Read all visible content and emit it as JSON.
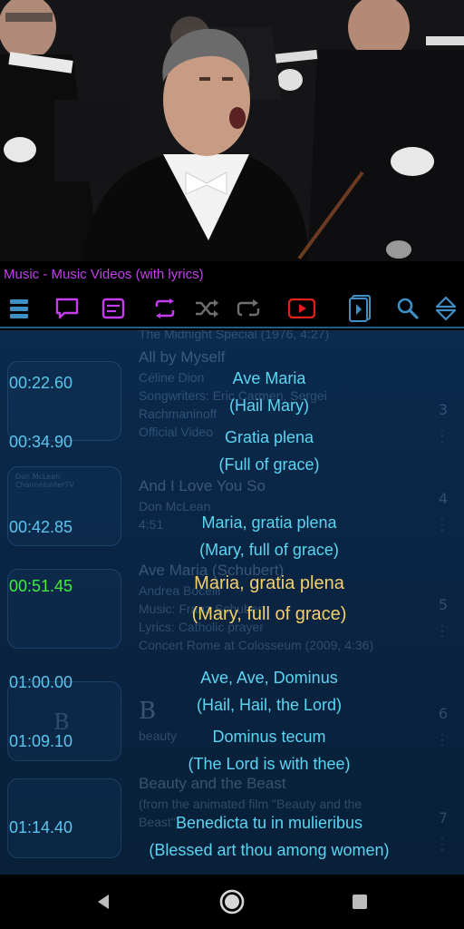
{
  "title": "Music - Music Videos (with lyrics)",
  "toolbar": {
    "icons": [
      "menu-icon",
      "chat-icon",
      "notes-icon",
      "repeat-icon",
      "shuffle-icon",
      "repeat-one-icon",
      "youtube-icon",
      "sidebar-toggle-icon",
      "search-icon",
      "sort-icon"
    ]
  },
  "background_list": [
    {
      "number": "",
      "title": "The Midnight Special (1976, 4:27)",
      "lines": []
    },
    {
      "number": "3",
      "title": "All by Myself",
      "lines": [
        "Céline Dion",
        "Songwriters: Eric Carmen, Sergei",
        "Rachmaninoff",
        "Official Video"
      ]
    },
    {
      "number": "4",
      "thumb_caption": "Don McLean ChannelunterTV",
      "title": "And I Love You So",
      "lines": [
        "Don McLean",
        "4:51"
      ]
    },
    {
      "number": "5",
      "title": "Ave Maria (Schubert)",
      "lines": [
        "Andrea Bocelli",
        "Music: Franz Schubert",
        "Lyrics: Catholic prayer",
        "Concert Rome at Colosseum (2009, 4:36)"
      ]
    },
    {
      "number": "6",
      "thumb_caption": "B",
      "title": "B",
      "lines": [
        "beauty"
      ]
    },
    {
      "number": "7",
      "title": "Beauty and the Beast",
      "lines": [
        "(from the animated film \"Beauty and the",
        "Beast\")"
      ]
    }
  ],
  "lyrics": [
    {
      "time": "00:22.60",
      "latin": "Ave Maria",
      "english": "(Hail Mary)",
      "active": false
    },
    {
      "time": "00:34.90",
      "latin": "Gratia plena",
      "english": "(Full of grace)",
      "active": false
    },
    {
      "time": "00:42.85",
      "latin": "Maria, gratia plena",
      "english": "(Mary, full of grace)",
      "active": false
    },
    {
      "time": "00:51.45",
      "latin": "Maria, gratia plena",
      "english": "(Mary, full of grace)",
      "active": true
    },
    {
      "time": "01:00.00",
      "latin": "Ave, Ave, Dominus",
      "english": "(Hail, Hail, the Lord)",
      "active": false
    },
    {
      "time": "01:09.10",
      "latin": "Dominus tecum",
      "english": "(The Lord is with thee)",
      "active": false
    },
    {
      "time": "01:14.40",
      "latin": "Benedicta tu in mulieribus",
      "english": "(Blessed art thou among women)",
      "active": false
    }
  ],
  "navbar": {
    "icons": [
      "back-icon",
      "home-icon",
      "recents-icon"
    ]
  },
  "colors": {
    "title": "#c63cf0",
    "timestamp": "#5ac6ef",
    "lyric": "#5ad6f2",
    "active_timestamp": "#3df03d",
    "active_lyric": "#f4d06a",
    "background": "#0a2442"
  }
}
